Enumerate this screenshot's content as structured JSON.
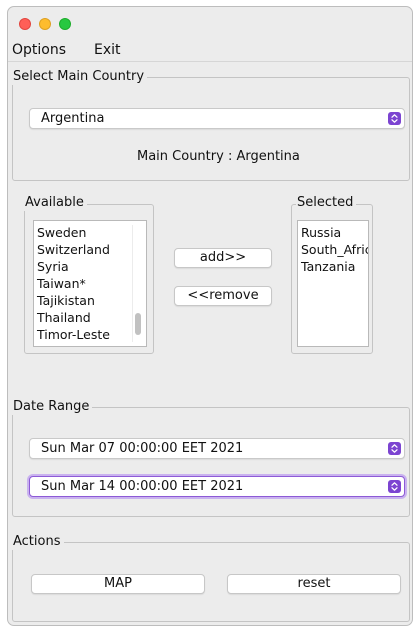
{
  "menu": {
    "options": "Options",
    "exit": "Exit"
  },
  "main_country": {
    "legend": "Select Main Country",
    "selected": "Argentina",
    "label": "Main Country : Argentina"
  },
  "available": {
    "legend": "Available",
    "items": [
      "Sweden",
      "Switzerland",
      "Syria",
      "Taiwan*",
      "Tajikistan",
      "Thailand",
      "Timor-Leste"
    ]
  },
  "buttons": {
    "add": "add>>",
    "remove": "<<remove"
  },
  "selected": {
    "legend": "Selected",
    "items": [
      "Russia",
      "South_Africa",
      "Tanzania"
    ]
  },
  "date_range": {
    "legend": "Date Range",
    "start": "Sun Mar 07 00:00:00 EET 2021",
    "end": "Sun Mar 14 00:00:00 EET 2021"
  },
  "actions": {
    "legend": "Actions",
    "map": "MAP",
    "reset": "reset"
  },
  "colors": {
    "accent": "#7c44d1",
    "focus_ring": "#c9b2ef",
    "window_bg": "#ececec"
  }
}
